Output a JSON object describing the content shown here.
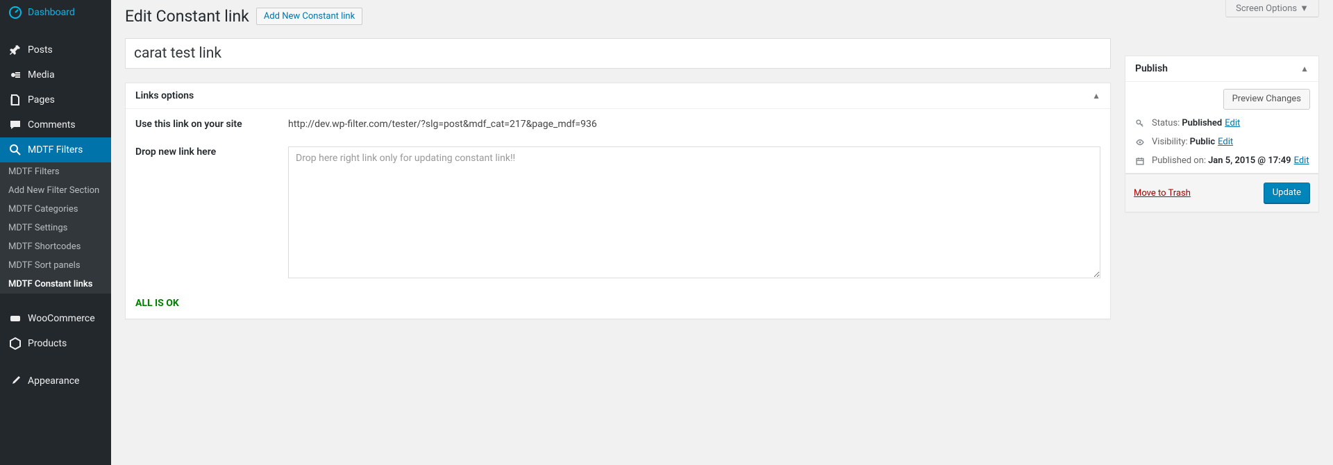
{
  "screen_options_label": "Screen Options",
  "header": {
    "title": "Edit Constant link",
    "add_new_label": "Add New Constant link"
  },
  "title_input_value": "carat test link",
  "links_options": {
    "heading": "Links options",
    "use_link_label": "Use this link on your site",
    "use_link_value": "http://dev.wp-filter.com/tester/?slg=post&mdf_cat=217&page_mdf=936",
    "drop_link_label": "Drop new link here",
    "drop_link_placeholder": "Drop here right link only for updating constant link!!",
    "status_text": "ALL IS OK"
  },
  "publish": {
    "heading": "Publish",
    "preview_label": "Preview Changes",
    "status_label": "Status:",
    "status_value": "Published",
    "visibility_label": "Visibility:",
    "visibility_value": "Public",
    "published_on_label": "Published on:",
    "published_on_value": "Jan 5, 2015 @ 17:49",
    "edit_label": "Edit",
    "trash_label": "Move to Trash",
    "update_label": "Update"
  },
  "sidebar": {
    "items": [
      {
        "label": "Dashboard",
        "icon": "dashboard"
      },
      {
        "label": "Posts",
        "icon": "pin"
      },
      {
        "label": "Media",
        "icon": "media"
      },
      {
        "label": "Pages",
        "icon": "pages"
      },
      {
        "label": "Comments",
        "icon": "comments"
      },
      {
        "label": "MDTF Filters",
        "icon": "search",
        "current": true
      },
      {
        "label": "WooCommerce",
        "icon": "woo"
      },
      {
        "label": "Products",
        "icon": "products"
      },
      {
        "label": "Appearance",
        "icon": "brush"
      }
    ],
    "submenu": [
      {
        "label": "MDTF Filters"
      },
      {
        "label": "Add New Filter Section"
      },
      {
        "label": "MDTF Categories"
      },
      {
        "label": "MDTF Settings"
      },
      {
        "label": "MDTF Shortcodes"
      },
      {
        "label": "MDTF Sort panels"
      },
      {
        "label": "MDTF Constant links",
        "current": true
      }
    ]
  }
}
